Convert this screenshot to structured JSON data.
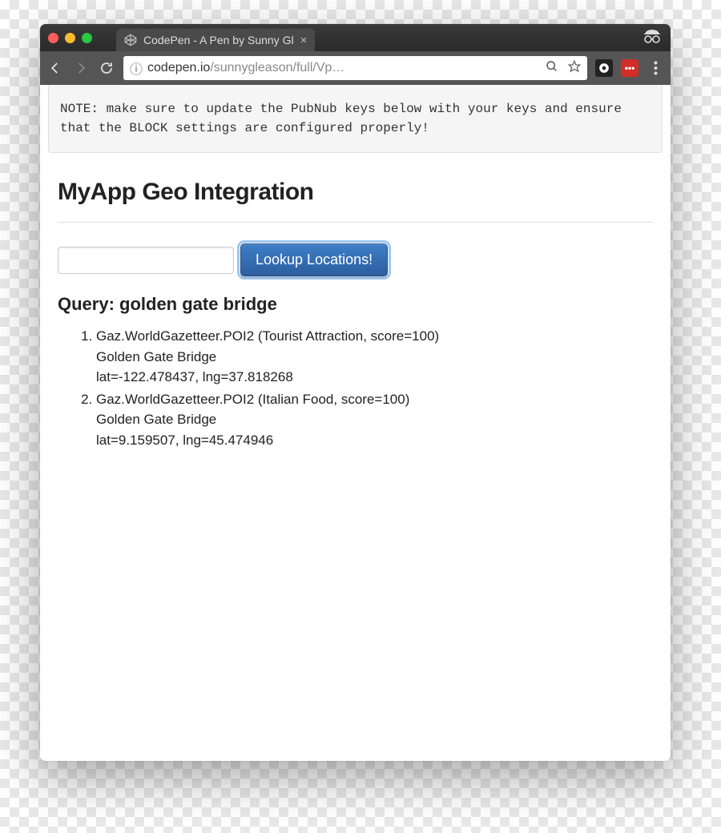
{
  "browser": {
    "tab_title": "CodePen - A Pen by Sunny Gl",
    "url_info_icon": "ⓘ",
    "url_domain": "codepen.io",
    "url_path": "/sunnygleason/full/Vp…"
  },
  "note": "NOTE: make sure to update the PubNub keys below with your keys and ensure that the BLOCK settings are configured properly!",
  "main": {
    "heading": "MyApp Geo Integration",
    "input_value": "",
    "button_label": "Lookup Locations!",
    "query_label": "Query: golden gate bridge",
    "results": [
      {
        "header": "Gaz.WorldGazetteer.POI2 (Tourist Attraction, score=100)",
        "name": "Golden Gate Bridge",
        "coords": "lat=-122.478437, lng=37.818268"
      },
      {
        "header": "Gaz.WorldGazetteer.POI2 (Italian Food, score=100)",
        "name": "Golden Gate Bridge",
        "coords": "lat=9.159507, lng=45.474946"
      }
    ]
  }
}
